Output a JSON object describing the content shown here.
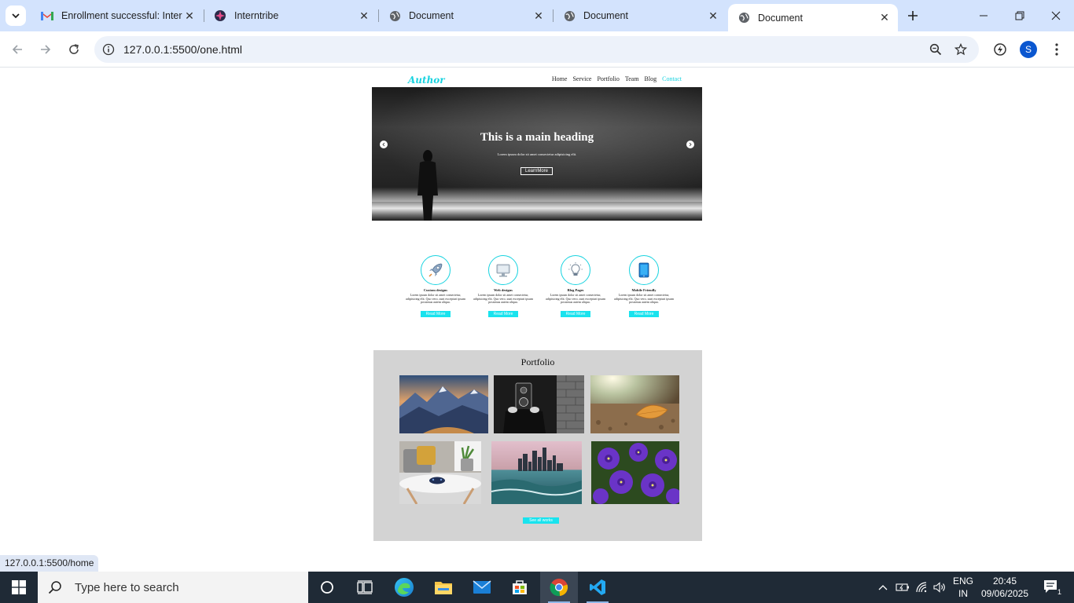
{
  "browser": {
    "tabs": [
      {
        "label": "Enrollment successful: Intern",
        "icon": "gmail-icon",
        "active": false
      },
      {
        "label": "Interntribe",
        "icon": "interntribe-icon",
        "active": false
      },
      {
        "label": "Document",
        "icon": "globe-icon",
        "active": false
      },
      {
        "label": "Document",
        "icon": "globe-icon",
        "active": false
      },
      {
        "label": "Document",
        "icon": "globe-icon",
        "active": true
      }
    ],
    "url": "127.0.0.1:5500/one.html",
    "profile_initial": "S",
    "status_url": "127.0.0.1:5500/home"
  },
  "site": {
    "logo": "Author",
    "nav": [
      "Home",
      "Service",
      "Portfolio",
      "Team",
      "Blog",
      "Contact"
    ],
    "hero": {
      "title": "This is a main heading",
      "subtitle": "Lorem ipsum dolor sit amet consectetur adipisicing elit.",
      "button": "LearnMore"
    },
    "services": [
      {
        "title": "Custom designs",
        "desc": "Lorem ipsum dolor sit amet consectetur, adipisicing elit. Quo vero, sunt excepturi ipsum possimus autem aliqua.",
        "button": "Read More",
        "icon": "rocket-icon"
      },
      {
        "title": "Web designs",
        "desc": "Lorem ipsum dolor sit amet consectetur, adipisicing elit. Quo vero, sunt excepturi ipsum possimus autem aliqua.",
        "button": "Read More",
        "icon": "monitor-icon"
      },
      {
        "title": "Blog Pages",
        "desc": "Lorem ipsum dolor sit amet consectetur, adipisicing elit. Quo vero, sunt excepturi ipsum possimus autem aliqua.",
        "button": "Read More",
        "icon": "lightbulb-icon"
      },
      {
        "title": "Mobile Friendly",
        "desc": "Lorem ipsum dolor sit amet consectetur, adipisicing elit. Quo vero, sunt excepturi ipsum possimus autem aliqua.",
        "button": "Read More",
        "icon": "tablet-icon"
      }
    ],
    "portfolio": {
      "title": "Portfolio",
      "images": [
        "mountains-photo",
        "camera-photo",
        "leaf-photo",
        "gamepad-table-photo",
        "city-skyline-photo",
        "purple-flowers-photo"
      ],
      "button": "See all works"
    }
  },
  "taskbar": {
    "search_placeholder": "Type here to search",
    "language": "ENG",
    "region": "IN",
    "time": "20:45",
    "date": "09/06/2025",
    "notification_count": "1"
  },
  "colors": {
    "accent": "#19d3e0",
    "tabstrip": "#d3e3fd",
    "taskbar": "#1f2a36"
  }
}
